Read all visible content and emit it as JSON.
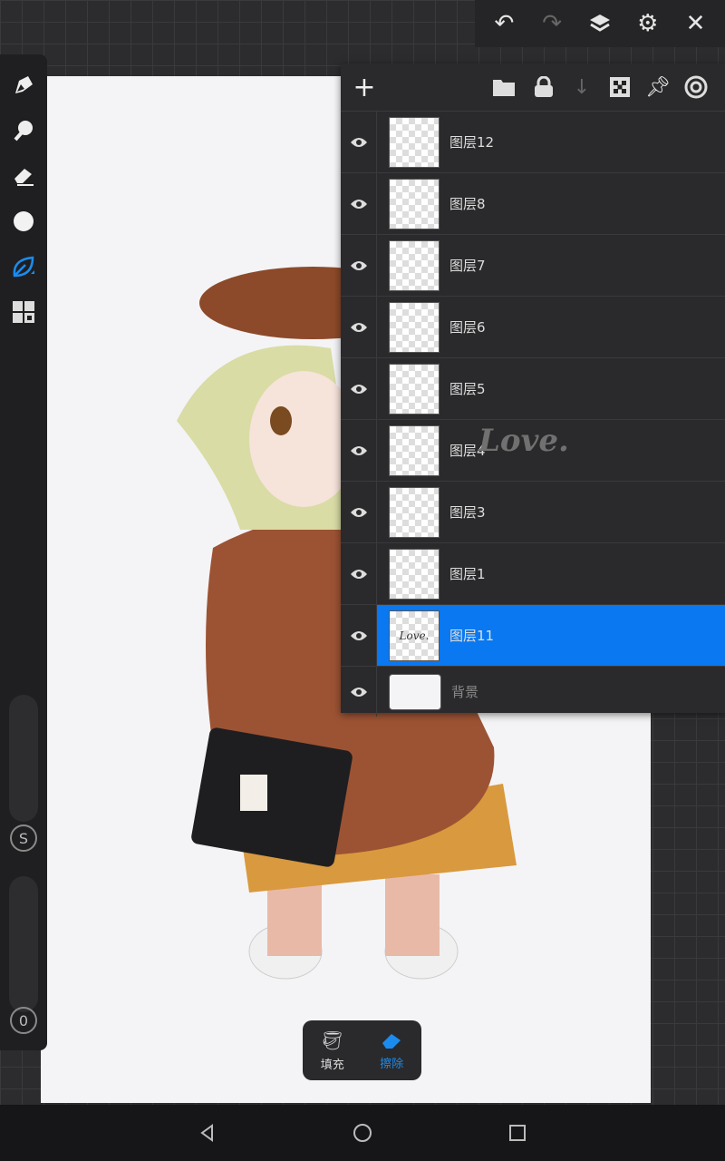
{
  "topbar": {
    "icons": [
      "undo-icon",
      "redo-icon",
      "layers-icon",
      "settings-icon",
      "close-icon"
    ]
  },
  "tools": [
    "pencil-icon",
    "smudge-icon",
    "eraser-icon",
    "color-icon",
    "brush-leaf-icon",
    "more-tools-icon"
  ],
  "sliders": {
    "size_label": "S",
    "opacity_label": "0"
  },
  "layer_panel": {
    "header_icons": [
      "add-icon",
      "folder-icon",
      "lock-icon",
      "merge-down-icon",
      "transparency-icon",
      "pin-icon",
      "target-icon"
    ],
    "layers": [
      {
        "name": "图层12",
        "selected": false
      },
      {
        "name": "图层8",
        "selected": false
      },
      {
        "name": "图层7",
        "selected": false
      },
      {
        "name": "图层6",
        "selected": false
      },
      {
        "name": "图层5",
        "selected": false
      },
      {
        "name": "图层4",
        "selected": false
      },
      {
        "name": "图层3",
        "selected": false
      },
      {
        "name": "图层1",
        "selected": false
      },
      {
        "name": "图层11",
        "selected": true,
        "thumb_text": "Love."
      },
      {
        "name": "背景",
        "selected": false
      }
    ]
  },
  "canvas_text": "Love.",
  "fill_tool": {
    "fill_label": "填充",
    "erase_label": "擦除"
  },
  "colors": {
    "accent": "#0a78f0"
  }
}
